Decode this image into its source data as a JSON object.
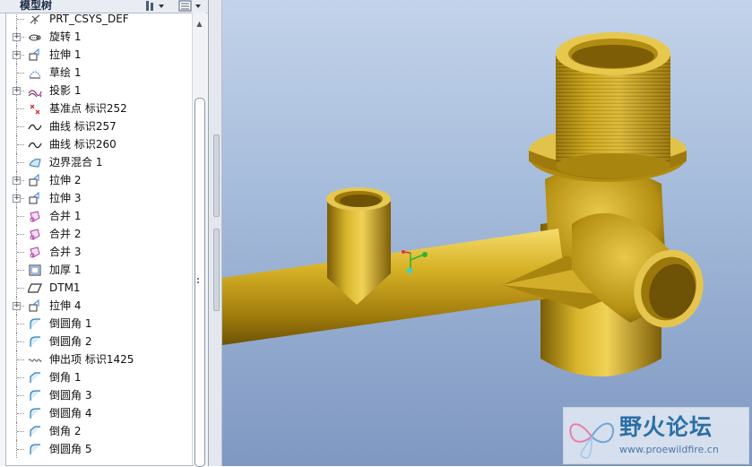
{
  "panel": {
    "title": "模型树"
  },
  "tree": {
    "items": [
      {
        "label": "PRT_CSYS_DEF",
        "icon": "csys-icon",
        "expandable": false
      },
      {
        "label": "旋转 1",
        "icon": "revolve-icon",
        "expandable": true
      },
      {
        "label": "拉伸 1",
        "icon": "extrude-icon",
        "expandable": true
      },
      {
        "label": "草绘 1",
        "icon": "sketch-icon",
        "expandable": false
      },
      {
        "label": "投影 1",
        "icon": "projection-icon",
        "expandable": true
      },
      {
        "label": "基准点 标识252",
        "icon": "datum-point-icon",
        "expandable": false
      },
      {
        "label": "曲线 标识257",
        "icon": "curve-icon",
        "expandable": false
      },
      {
        "label": "曲线 标识260",
        "icon": "curve-icon",
        "expandable": false
      },
      {
        "label": "边界混合 1",
        "icon": "boundary-blend-icon",
        "expandable": false
      },
      {
        "label": "拉伸 2",
        "icon": "extrude-icon",
        "expandable": true
      },
      {
        "label": "拉伸 3",
        "icon": "extrude-icon",
        "expandable": true
      },
      {
        "label": "合并 1",
        "icon": "merge-icon",
        "expandable": false
      },
      {
        "label": "合并 2",
        "icon": "merge-icon",
        "expandable": false
      },
      {
        "label": "合并 3",
        "icon": "merge-icon",
        "expandable": false
      },
      {
        "label": "加厚 1",
        "icon": "thicken-icon",
        "expandable": false
      },
      {
        "label": "DTM1",
        "icon": "datum-plane-icon",
        "expandable": false
      },
      {
        "label": "拉伸 4",
        "icon": "extrude-icon",
        "expandable": true
      },
      {
        "label": "倒圆角 1",
        "icon": "round-icon",
        "expandable": false
      },
      {
        "label": "倒圆角 2",
        "icon": "round-icon",
        "expandable": false
      },
      {
        "label": "伸出项 标识1425",
        "icon": "protrusion-icon",
        "expandable": false
      },
      {
        "label": "倒角 1",
        "icon": "chamfer-icon",
        "expandable": false
      },
      {
        "label": "倒圆角 3",
        "icon": "round-icon",
        "expandable": false
      },
      {
        "label": "倒圆角 4",
        "icon": "round-icon",
        "expandable": false
      },
      {
        "label": "倒角 2",
        "icon": "chamfer-icon",
        "expandable": false
      },
      {
        "label": "倒圆角 5",
        "icon": "round-icon",
        "expandable": false
      }
    ]
  },
  "watermark": {
    "title": "野火论坛",
    "url": "www.proewildfire.cn"
  },
  "colors": {
    "brass": "#c9a21a",
    "brass_dark": "#6e5205",
    "brass_light": "#f0d35a",
    "viewport_top": "#c3d3ea",
    "viewport_bottom": "#7f98c2"
  }
}
